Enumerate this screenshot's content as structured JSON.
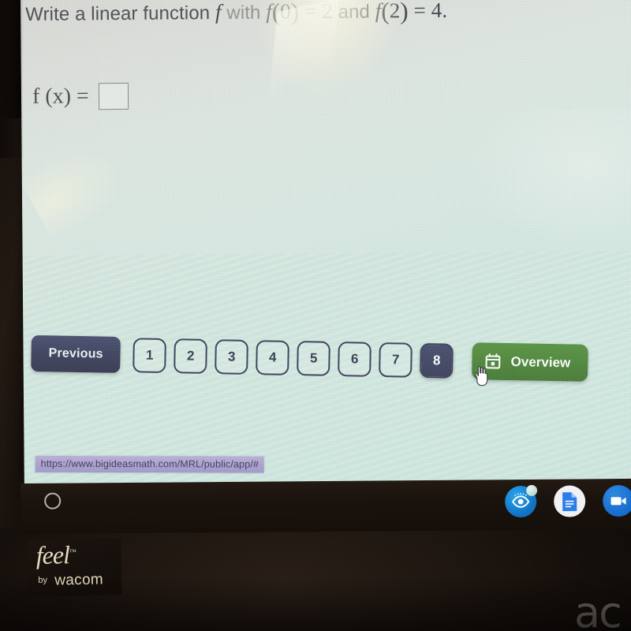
{
  "question": {
    "part1": "Write a linear function",
    "var_f": "f",
    "part2": "with",
    "eq1_f": "f",
    "eq1_lparen": "(",
    "eq1_arg": "0",
    "eq1_rparen": ")",
    "eq1_eq": "=",
    "eq1_val": "2",
    "conj": "and",
    "eq2_f": "f",
    "eq2_lparen": "(",
    "eq2_arg": "2",
    "eq2_rparen": ")",
    "eq2_eq": "=",
    "eq2_val": "4",
    "period": "."
  },
  "answer": {
    "lhs": "f (x) =",
    "value": "",
    "placeholder": ""
  },
  "nav": {
    "previous_label": "Previous",
    "pages": [
      {
        "label": "1",
        "active": false
      },
      {
        "label": "2",
        "active": false
      },
      {
        "label": "3",
        "active": false
      },
      {
        "label": "4",
        "active": false
      },
      {
        "label": "5",
        "active": false
      },
      {
        "label": "6",
        "active": false
      },
      {
        "label": "7",
        "active": false
      },
      {
        "label": "8",
        "active": true
      }
    ],
    "overview_label": "Overview",
    "overview_icon": "calendar-icon",
    "active_page": "8"
  },
  "status_bar": {
    "url": "https://www.bigideasmath.com/MRL/public/app/#"
  },
  "shelf": {
    "launcher_icon": "launcher-circle-icon",
    "tray_icons": [
      {
        "name": "eye-accessibility-icon",
        "badge": true
      },
      {
        "name": "google-docs-icon",
        "badge": false
      },
      {
        "name": "video-camera-icon",
        "badge": false
      }
    ]
  },
  "device": {
    "wacom_brand": "feel",
    "wacom_tm": "™",
    "wacom_by": "by",
    "wacom_name": "wacom",
    "oem_logo": "ac"
  },
  "colors": {
    "nav_dark": "#2b2e4c",
    "overview_green": "#3f7a27",
    "status_purple": "#a89ad0",
    "screen_bg": "#d8e8e2",
    "text_dark": "#33333c"
  }
}
